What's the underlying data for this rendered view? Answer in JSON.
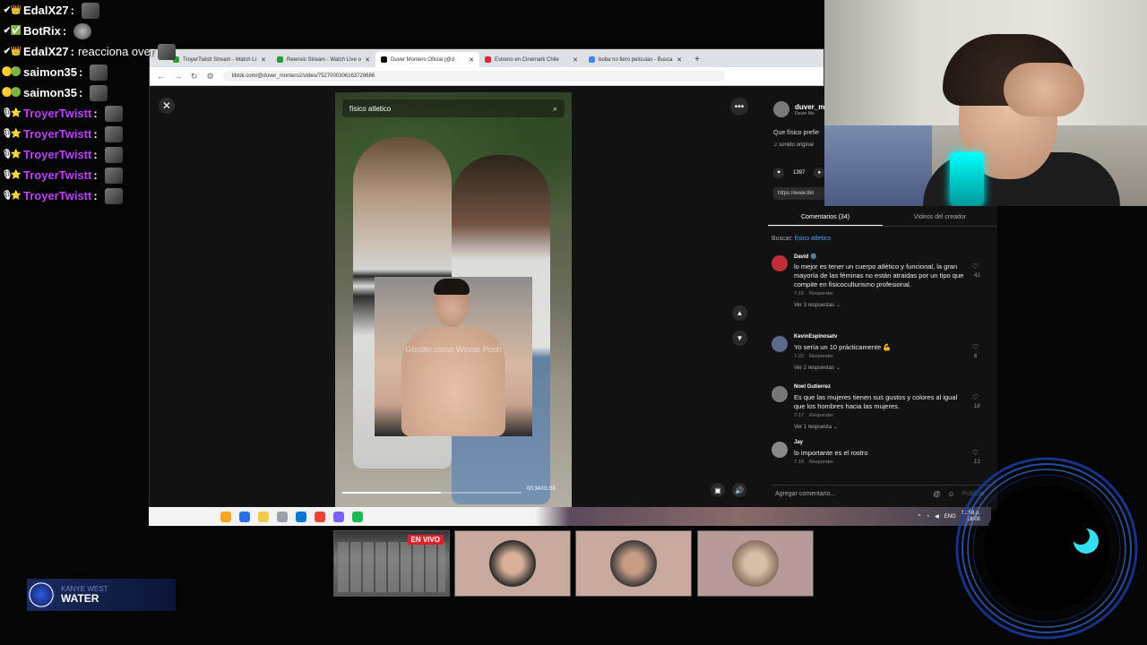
{
  "chat": [
    {
      "user": "EdalX27",
      "color": "#ffffff",
      "badges": [
        "✔",
        "👑"
      ],
      "msg": ""
    },
    {
      "user": "BotRix",
      "color": "#ffffff",
      "badges": [
        "✔",
        "✅"
      ],
      "msg": ""
    },
    {
      "user": "EdalX27",
      "color": "#ffffff",
      "badges": [
        "✔",
        "👑"
      ],
      "msg": "reacciona over"
    },
    {
      "user": "saimon35",
      "color": "#ffffff",
      "badges": [
        "🟡",
        "🟢"
      ],
      "msg": ""
    },
    {
      "user": "saimon35",
      "color": "#ffffff",
      "badges": [
        "🟡",
        "🟢"
      ],
      "msg": ""
    },
    {
      "user": "TroyerTwistt",
      "color": "#c040ff",
      "badges": [
        "🎙",
        "⭐"
      ],
      "msg": ""
    },
    {
      "user": "TroyerTwistt",
      "color": "#c040ff",
      "badges": [
        "🎙",
        "⭐"
      ],
      "msg": ""
    },
    {
      "user": "TroyerTwistt",
      "color": "#c040ff",
      "badges": [
        "🎙",
        "⭐"
      ],
      "msg": ""
    },
    {
      "user": "TroyerTwistt",
      "color": "#c040ff",
      "badges": [
        "🎙",
        "⭐"
      ],
      "msg": ""
    },
    {
      "user": "TroyerTwistt",
      "color": "#c040ff",
      "badges": [
        "🎙",
        "⭐"
      ],
      "msg": ""
    }
  ],
  "browser": {
    "tabs": [
      {
        "label": "TroyerTwistt Stream - Watch Li",
        "fav": "#2a9d3a",
        "active": false
      },
      {
        "label": "Reenvio Stream - Watch Live o",
        "fav": "#2a9d3a",
        "active": false
      },
      {
        "label": "Duver Montero Oficial (@d",
        "fav": "#111111",
        "active": true
      },
      {
        "label": "Estreno en Cinemark Chile",
        "fav": "#d9263a",
        "active": false
      },
      {
        "label": "boba no fiero películas - Busca",
        "fav": "#4285f4",
        "active": false
      }
    ],
    "new_tab": "+",
    "url": "tiktok.com/@duver_montero2/video/7527000306163729686"
  },
  "video": {
    "search_text": "físico atletico",
    "overlay_caption": "Gordito como Winnie Pooh",
    "progress": 0.55,
    "time": "00:34/01:09"
  },
  "panel": {
    "creator_name": "duver_m",
    "creator_sub": "Duver Mo",
    "caption": "Que físico prefie",
    "sound": "♫ sonido original",
    "likes": "1397",
    "link": "https://www.tikt",
    "tab_comments": "Comentarios (34)",
    "tab_creator": "Videos del creador",
    "search_label": "Buscar:",
    "search_query": "físico atletico",
    "reply_label": "Responder",
    "add_placeholder": "Agregar comentario...",
    "post": "Publicar",
    "comments": [
      {
        "name": "David 🌚",
        "text": "lo mejor es tener un cuerpo atlético y funcional, la gran mayoría de las féminas no están atraidas por un tipo que compite en fisicoculturismo profesional.",
        "date": "7-16",
        "replies": "Ver 3 respuestas ⌄",
        "likes": "42",
        "avatar": "#c0303a"
      },
      {
        "name": "KevinEspinosatv",
        "text": "Yo sería un 10 prácticamente 💪",
        "date": "7-22",
        "replies": "Ver 2 respuestas ⌄",
        "likes": "6",
        "avatar": "#5a6a8a"
      },
      {
        "name": "Noel Gutierrez",
        "text": "Es que las mujeres tienen sus gustos y colores al igual que los hombres hacia las mujeres.",
        "date": "7-17",
        "replies": "Ver 1 respuesta ⌄",
        "likes": "18",
        "avatar": "#777777"
      },
      {
        "name": "Jay",
        "text": "lo importante es el rostro",
        "date": "7-18",
        "replies": "",
        "likes": "13",
        "avatar": "#888888"
      }
    ]
  },
  "taskbar": {
    "icons": [
      "#f5a623",
      "#2f6fe4",
      "#f2c94c",
      "#9aa0a6",
      "#0078d4",
      "#ea4335",
      "#7b61ff",
      "#1db954"
    ],
    "lang": "ENG",
    "time": "11:58 p.",
    "date": "18/08"
  },
  "thumbs": {
    "live_label": "EN VIVO"
  },
  "now_playing": {
    "artist": "KANYE WEST",
    "song": "WATER"
  }
}
